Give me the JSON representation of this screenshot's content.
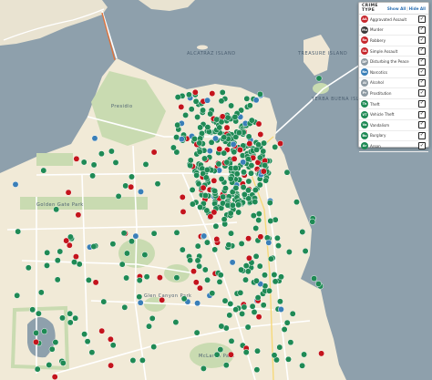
{
  "map": {
    "labels": {
      "alcatraz": "ALCATRAZ ISLAND",
      "treasure": "TREASURE ISLAND",
      "yerba": "YERBA BUENA ISLAND",
      "glen_park": "Glen Canyon Park",
      "mclaren": "McLaren Park",
      "golden_gate_park": "Golden Gate Park",
      "presidio": "Presidio"
    },
    "colors": {
      "water": "#8ea0ac",
      "land": "#f1ead7",
      "park": "#c9dbb1",
      "road": "#ffffff",
      "green_point": "#1f8a55",
      "red_point": "#c4141c",
      "blue_point": "#3a7fb8"
    }
  },
  "crime_panel": {
    "header": "CRIME TYPE",
    "show_all": "Show All",
    "separator": "|",
    "hide_all": "Hide All",
    "checkmark": "✓",
    "types": [
      {
        "abbr": "AA",
        "name": "Aggravated Assault",
        "color": "#c7282e",
        "checked": true
      },
      {
        "abbr": "Mu",
        "name": "Murder",
        "color": "#3c3c3c",
        "checked": true
      },
      {
        "abbr": "Ro",
        "name": "Robbery",
        "color": "#c7282e",
        "checked": true
      },
      {
        "abbr": "SA",
        "name": "Simple Assault",
        "color": "#c7282e",
        "checked": true
      },
      {
        "abbr": "DP",
        "name": "Disturbing the Peace",
        "color": "#8e9aa3",
        "checked": true
      },
      {
        "abbr": "Na",
        "name": "Narcotics",
        "color": "#3a7fb8",
        "checked": true
      },
      {
        "abbr": "Al",
        "name": "Alcohol",
        "color": "#8e9aa3",
        "checked": true
      },
      {
        "abbr": "Pr",
        "name": "Prostitution",
        "color": "#8e9aa3",
        "checked": true
      },
      {
        "abbr": "Th",
        "name": "Theft",
        "color": "#1f8a55",
        "checked": true
      },
      {
        "abbr": "VT",
        "name": "Vehicle Theft",
        "color": "#1f8a55",
        "checked": true
      },
      {
        "abbr": "Va",
        "name": "Vandalism",
        "color": "#1f8a55",
        "checked": true
      },
      {
        "abbr": "Bu",
        "name": "Burglary",
        "color": "#1f8a55",
        "checked": true
      },
      {
        "abbr": "Ar",
        "name": "Arson",
        "color": "#1f8a55",
        "checked": true
      }
    ]
  }
}
